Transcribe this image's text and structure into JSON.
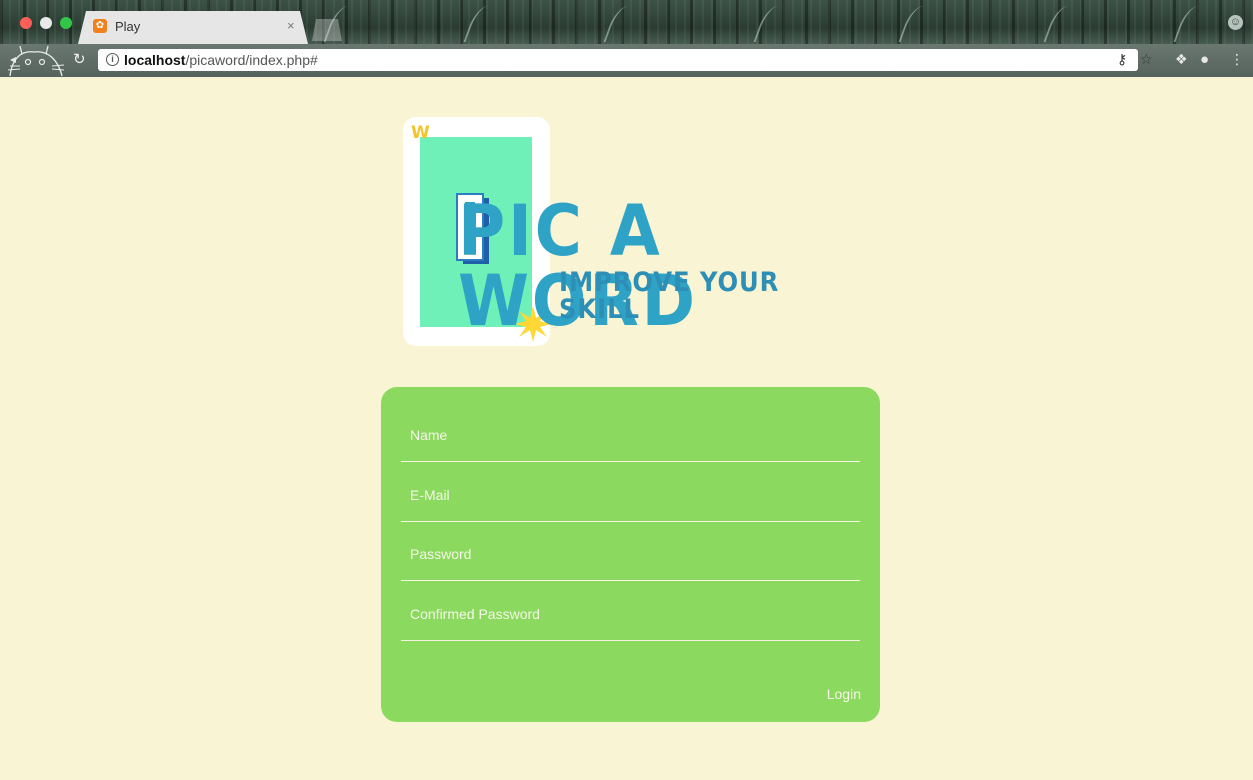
{
  "browser": {
    "tab_title": "Play",
    "tab_favicon": "xampp-icon",
    "tab_close": "×",
    "url_host": "localhost",
    "url_path": "/picaword/index.php#",
    "icons": [
      "info-icon",
      "reload-icon",
      "key-icon",
      "star-icon",
      "dropbox-icon",
      "extension-icon",
      "menu-icon",
      "profile-icon"
    ]
  },
  "logo": {
    "title": "PIC A WORD",
    "tagline": "IMPROVE YOUR SKILL",
    "card_letter": "W",
    "colors": {
      "title": "#2fa3c6",
      "card": "#6ff0b9",
      "star": "#ffd836"
    }
  },
  "form": {
    "fields": [
      {
        "placeholder": "Name",
        "value": ""
      },
      {
        "placeholder": "E-Mail",
        "value": ""
      },
      {
        "placeholder": "Password",
        "value": ""
      },
      {
        "placeholder": "Confirmed Password",
        "value": ""
      }
    ],
    "submit_label": "Login",
    "colors": {
      "card": "#8cd960",
      "background": "#f9f5d4"
    }
  }
}
